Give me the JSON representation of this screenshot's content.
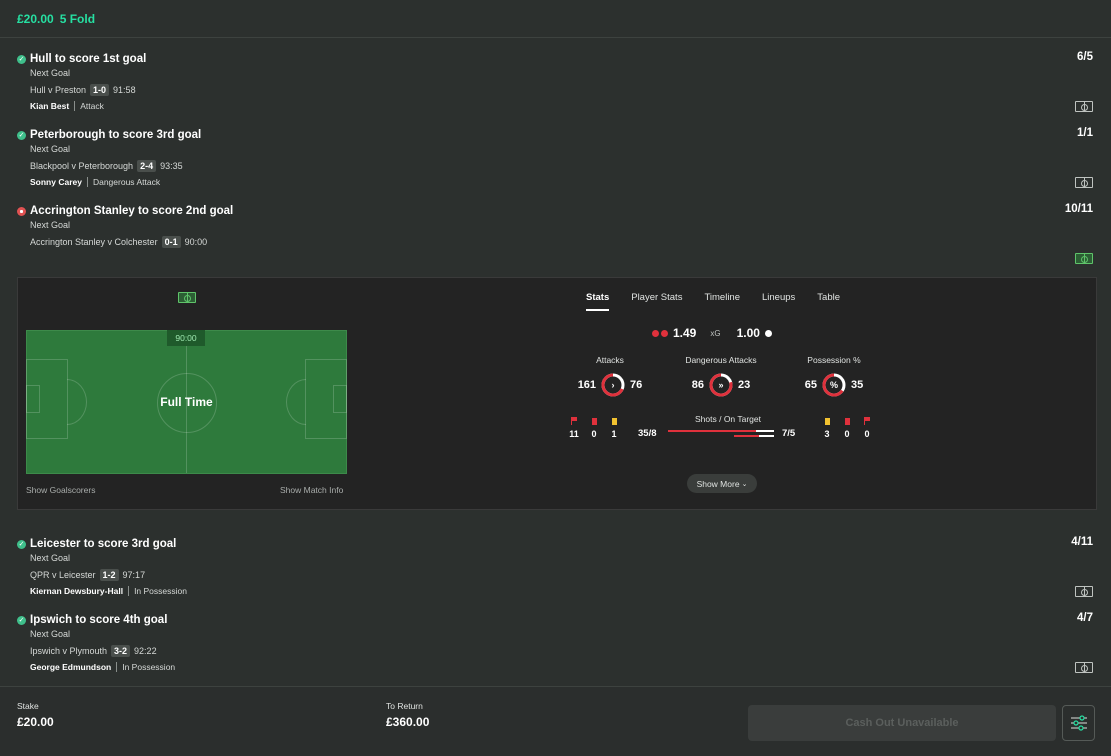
{
  "header": {
    "stake": "£20.00",
    "bet_type": "5 Fold"
  },
  "selections_top": [
    {
      "title": "Hull to score 1st goal",
      "odds": "6/5",
      "market": "Next Goal",
      "match": "Hull v Preston",
      "score": "1-0",
      "time": "91:58",
      "player": "Kian Best",
      "state": "Attack",
      "status": "won"
    },
    {
      "title": "Peterborough to score 3rd goal",
      "odds": "1/1",
      "market": "Next Goal",
      "match": "Blackpool v Peterborough",
      "score": "2-4",
      "time": "93:35",
      "player": "Sonny Carey",
      "state": "Dangerous Attack",
      "status": "won"
    },
    {
      "title": "Accrington Stanley to score 2nd goal",
      "odds": "10/11",
      "market": "Next Goal",
      "match": "Accrington Stanley v Colchester",
      "score": "0-1",
      "time": "90:00",
      "status": "live"
    }
  ],
  "panel": {
    "field": {
      "clock": "90:00",
      "status": "Full Time"
    },
    "links": {
      "goalscorers": "Show Goalscorers",
      "match_info": "Show Match Info"
    },
    "tabs": [
      "Stats",
      "Player Stats",
      "Timeline",
      "Lineups",
      "Table"
    ],
    "active_tab": "Stats",
    "xg": {
      "home": "1.49",
      "label": "xG",
      "away": "1.00"
    },
    "stats": [
      {
        "title": "Attacks",
        "home": "161",
        "away": "76",
        "glyph": "›",
        "home_share": 0.68
      },
      {
        "title": "Dangerous Attacks",
        "home": "86",
        "away": "23",
        "glyph": "»",
        "home_share": 0.79
      },
      {
        "title": "Possession %",
        "home": "65",
        "away": "35",
        "glyph": "%",
        "home_share": 0.65
      }
    ],
    "home_discipline": {
      "corners": "11",
      "red": "0",
      "yellow": "1"
    },
    "away_discipline": {
      "yellow": "3",
      "red": "0",
      "corners": "0"
    },
    "shots": {
      "title": "Shots / On Target",
      "home": "35/8",
      "away": "7/5",
      "home_shots": 35,
      "away_shots": 7,
      "home_on_target": 8,
      "away_on_target": 5
    },
    "show_more": "Show More"
  },
  "selections_bottom": [
    {
      "title": "Leicester to score 3rd goal",
      "odds": "4/11",
      "market": "Next Goal",
      "match": "QPR v Leicester",
      "score": "1-2",
      "time": "97:17",
      "player": "Kiernan Dewsbury-Hall",
      "state": "In Possession",
      "status": "won"
    },
    {
      "title": "Ipswich to score 4th goal",
      "odds": "4/7",
      "market": "Next Goal",
      "match": "Ipswich v Plymouth",
      "score": "3-2",
      "time": "92:22",
      "player": "George Edmundson",
      "state": "In Possession",
      "status": "won"
    }
  ],
  "footer": {
    "stake_label": "Stake",
    "stake_value": "£20.00",
    "return_label": "To Return",
    "return_value": "£360.00",
    "cashout_label": "Cash Out Unavailable"
  },
  "colors": {
    "accent": "#26e0a2",
    "won": "#3fbf8b",
    "live": "#e05252",
    "home": "#e0313c",
    "away": "#ffffff"
  }
}
